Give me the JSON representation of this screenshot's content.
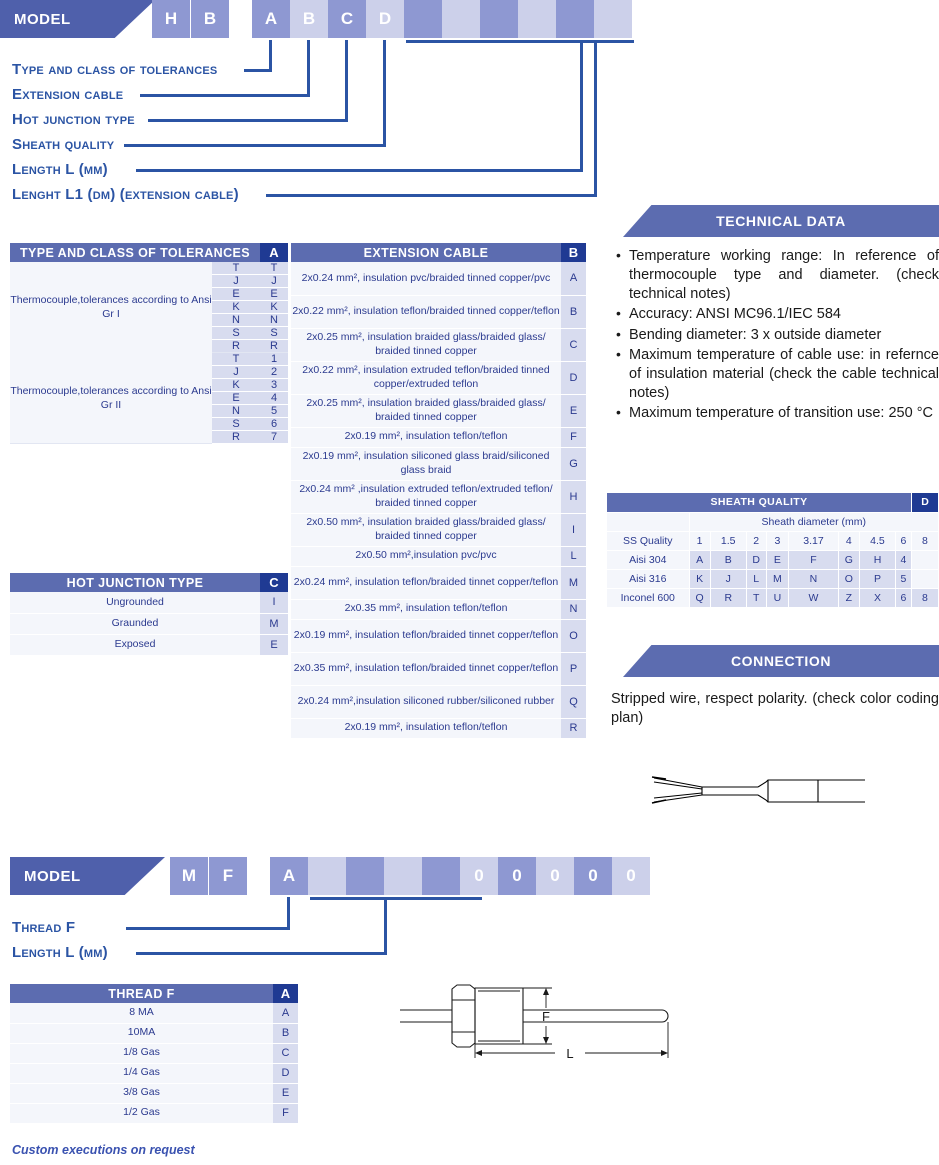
{
  "colors": {
    "banner_blue": "#4f60ab",
    "header_blue": "#5c6cb0",
    "code_navy": "#1f3a93",
    "cell_dark": "#8e98d2",
    "cell_light": "#ccd0ea",
    "line_blue": "#2b54a4",
    "text_blue": "#2b3a8f"
  },
  "model_top": {
    "banner_label": "MODEL",
    "prefix_cells": [
      "H",
      "B"
    ],
    "code_cells": [
      "A",
      "B",
      "C",
      "D"
    ],
    "blank_cells": [
      "",
      "",
      "",
      "",
      "",
      ""
    ],
    "legend": [
      "Type and class of tolerances",
      "Extension cable",
      "Hot junction type",
      "Sheath quality",
      "Length L (mm)",
      "Lenght L1 (dm) (extension cable)"
    ]
  },
  "model_bottom": {
    "banner_label": "MODEL",
    "prefix_cells": [
      "M",
      "F"
    ],
    "code_cells": [
      "A"
    ],
    "blank_cells": [
      "",
      "",
      "",
      ""
    ],
    "zero_cells": [
      "0",
      "0",
      "0",
      "0",
      "0"
    ],
    "legend": [
      "Thread F",
      "Length L (mm)"
    ]
  },
  "tolerances_table": {
    "title": "TYPE AND CLASS OF TOLERANCES",
    "code_header": "A",
    "groups": [
      {
        "label": "Thermocouple,tolerances according to Ansi Gr I",
        "types": [
          "T",
          "J",
          "E",
          "K",
          "N",
          "S",
          "R"
        ],
        "codes": [
          "T",
          "J",
          "E",
          "K",
          "N",
          "S",
          "R"
        ]
      },
      {
        "label": "Thermocouple,tolerances according to Ansi Gr II",
        "types": [
          "T",
          "J",
          "K",
          "E",
          "N",
          "S",
          "R"
        ],
        "codes": [
          "1",
          "2",
          "3",
          "4",
          "5",
          "6",
          "7"
        ]
      }
    ]
  },
  "extension_cable_table": {
    "title": "EXTENSION CABLE",
    "code_header": "B",
    "rows": [
      {
        "desc": "2x0.24 mm², insulation pvc/braided tinned copper/pvc",
        "code": "A"
      },
      {
        "desc": "2x0.22 mm², insulation teflon/braided tinned copper/teflon",
        "code": "B"
      },
      {
        "desc": "2x0.25 mm², insulation braided glass/braided glass/ braided tinned copper",
        "code": "C"
      },
      {
        "desc": "2x0.22 mm², insulation extruded teflon/braided tinned copper/extruded teflon",
        "code": "D"
      },
      {
        "desc": "2x0.25 mm², insulation braided glass/braided glass/ braided tinned copper",
        "code": "E"
      },
      {
        "desc": "2x0.19 mm², insulation teflon/teflon",
        "code": "F"
      },
      {
        "desc": "2x0.19 mm², insulation siliconed glass braid/siliconed glass braid",
        "code": "G"
      },
      {
        "desc": "2x0.24 mm²  ,insulation extruded teflon/extruded teflon/ braided tinned copper",
        "code": "H"
      },
      {
        "desc": "2x0.50 mm², insulation braided glass/braided glass/ braided tinned copper",
        "code": "I"
      },
      {
        "desc": "2x0.50 mm²,insulation pvc/pvc",
        "code": "L"
      },
      {
        "desc": "2x0.24 mm², insulation teflon/braided tinnet copper/teflon",
        "code": "M"
      },
      {
        "desc": "2x0.35 mm², insulation teflon/teflon",
        "code": "N"
      },
      {
        "desc": "2x0.19 mm², insulation teflon/braided tinnet copper/teflon",
        "code": "O"
      },
      {
        "desc": "2x0.35 mm², insulation teflon/braided tinnet copper/teflon",
        "code": "P"
      },
      {
        "desc": "2x0.24 mm²,insulation siliconed rubber/siliconed rubber",
        "code": "Q"
      },
      {
        "desc": "2x0.19 mm², insulation teflon/teflon",
        "code": "R"
      }
    ]
  },
  "hot_junction_table": {
    "title": "HOT JUNCTION TYPE",
    "code_header": "C",
    "rows": [
      {
        "desc": "Ungrounded",
        "code": "I"
      },
      {
        "desc": "Graunded",
        "code": "M"
      },
      {
        "desc": "Exposed",
        "code": "E"
      }
    ]
  },
  "technical_data": {
    "title": "TECHNICAL DATA",
    "items": [
      "Temperature working range: In reference of thermocouple type and diameter. (check technical notes)",
      "Accuracy: ANSI MC96.1/IEC 584",
      "Bending diameter: 3 x outside diameter",
      "Maximum temperature of cable use: in refernce of insulation material (check the cable technical notes)",
      "Maximum temperature of transition use: 250 °C"
    ]
  },
  "sheath_quality_table": {
    "title": "SHEATH QUALITY",
    "code_header": "D",
    "diameter_header": "Sheath diameter (mm)",
    "quality_label": "SS Quality",
    "diameters": [
      "1",
      "1.5",
      "2",
      "3",
      "3.17",
      "4",
      "4.5",
      "6",
      "8"
    ],
    "rows": [
      {
        "quality": "Aisi 304",
        "codes": [
          "A",
          "B",
          "D",
          "E",
          "F",
          "G",
          "H",
          "4",
          ""
        ]
      },
      {
        "quality": "Aisi 316",
        "codes": [
          "K",
          "J",
          "L",
          "M",
          "N",
          "O",
          "P",
          "5",
          ""
        ]
      },
      {
        "quality": "Inconel 600",
        "codes": [
          "Q",
          "R",
          "T",
          "U",
          "W",
          "Z",
          "X",
          "6",
          "8"
        ]
      }
    ]
  },
  "connection": {
    "title": "CONNECTION",
    "text": "Stripped wire, respect polarity. (check color coding plan)"
  },
  "thread_table": {
    "title": "THREAD F",
    "code_header": "A",
    "rows": [
      {
        "desc": "8 MA",
        "code": "A"
      },
      {
        "desc": "10MA",
        "code": "B"
      },
      {
        "desc": "1/8 Gas",
        "code": "C"
      },
      {
        "desc": "1/4 Gas",
        "code": "D"
      },
      {
        "desc": "3/8 Gas",
        "code": "E"
      },
      {
        "desc": "1/2 Gas",
        "code": "F"
      }
    ]
  },
  "probe_drawing": {
    "dim_f": "F",
    "dim_l": "L"
  },
  "footnote": "Custom executions on request"
}
